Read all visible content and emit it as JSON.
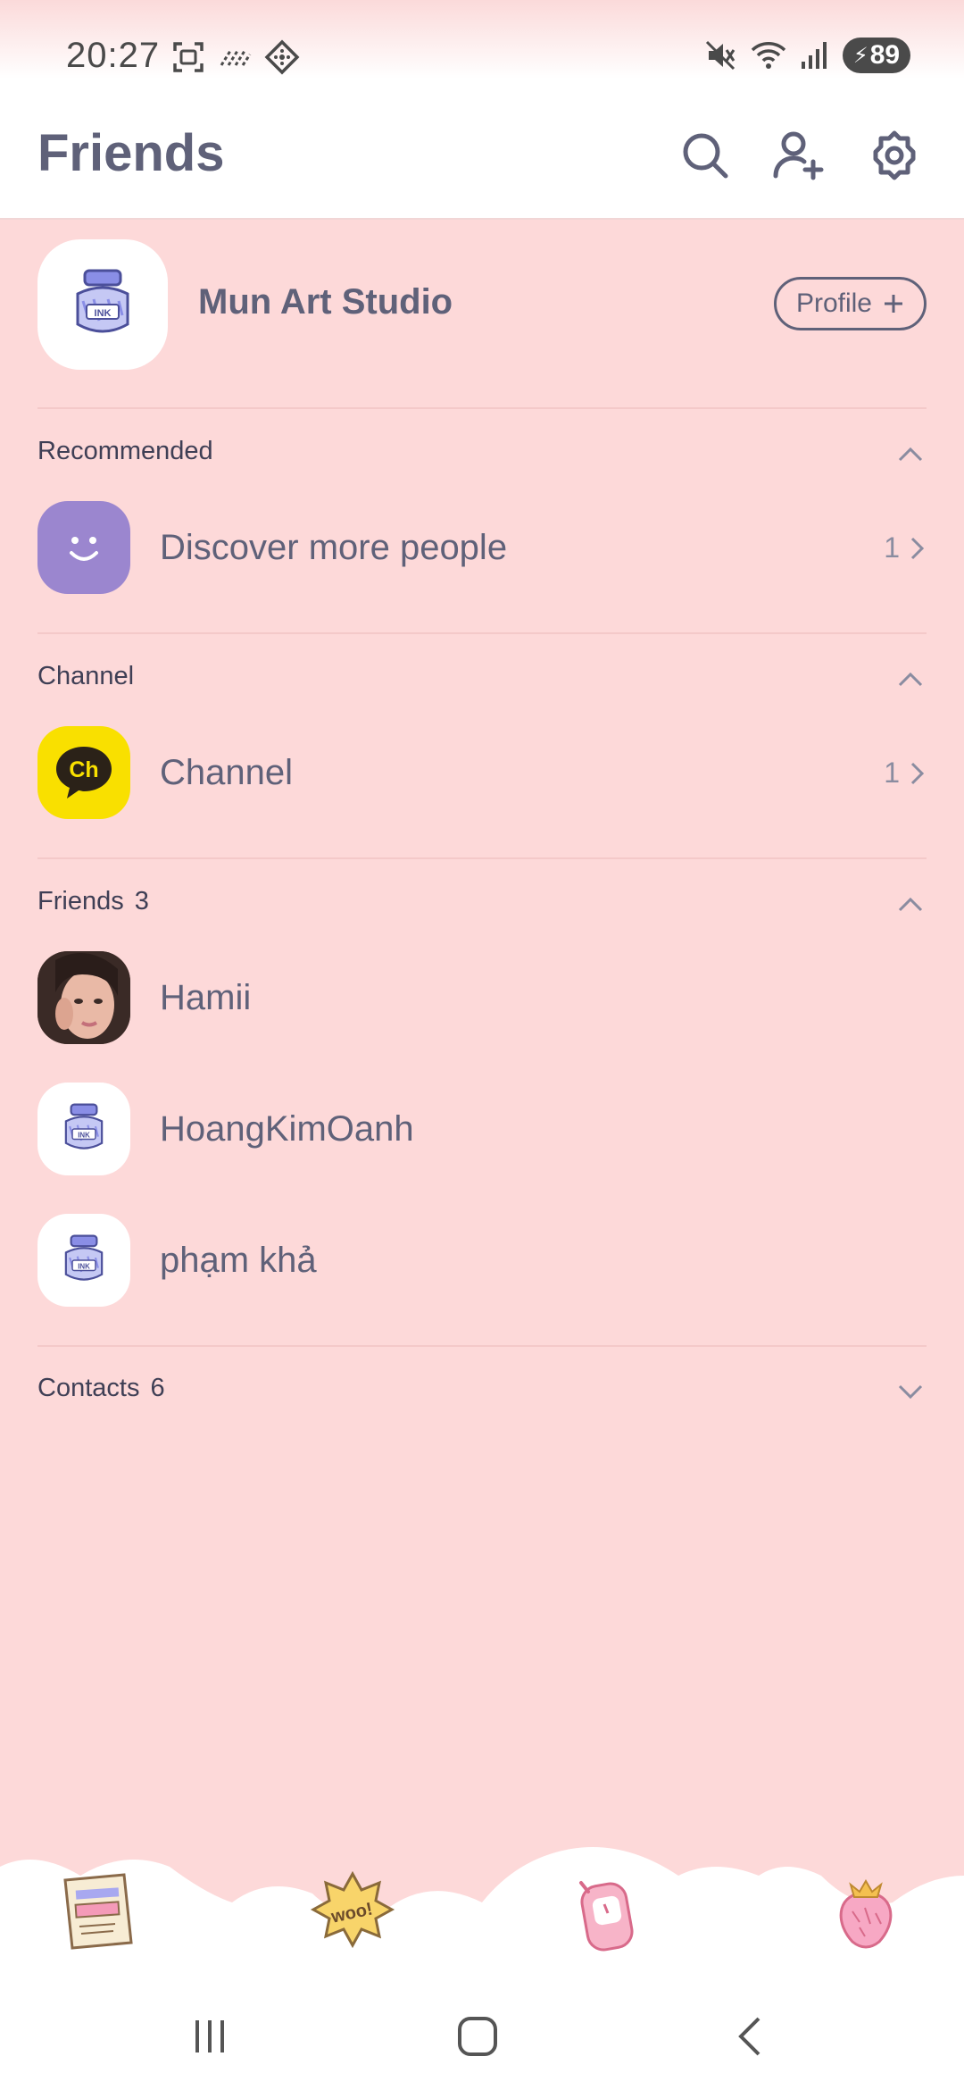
{
  "status_bar": {
    "time": "20:27",
    "battery": "89",
    "icons": [
      "screenshot-icon",
      "data-icon",
      "vpn-icon",
      "mute-icon",
      "wifi-icon",
      "signal-icon",
      "battery-icon"
    ]
  },
  "header": {
    "title": "Friends",
    "icons": [
      "search-icon",
      "add-friend-icon",
      "settings-icon"
    ]
  },
  "profile": {
    "name": "Mun Art Studio",
    "button_label": "Profile"
  },
  "sections": {
    "recommended": {
      "title": "Recommended",
      "item_label": "Discover more people",
      "item_count": "1"
    },
    "channel": {
      "title": "Channel",
      "item_label": "Channel",
      "item_count": "1",
      "icon_text": "Ch"
    },
    "friends": {
      "title": "Friends",
      "count": "3",
      "items": [
        {
          "name": "Hamii"
        },
        {
          "name": "HoangKimOanh"
        },
        {
          "name": "phạm khả"
        }
      ]
    },
    "contacts": {
      "title": "Contacts",
      "count": "6"
    }
  },
  "avatar_badge_text": "INK",
  "tab_sticker_text": "woo!",
  "colors": {
    "background": "#fdd9d9",
    "text": "#5f6179",
    "discover_avatar": "#9b86cf",
    "channel_avatar": "#f9e000"
  }
}
